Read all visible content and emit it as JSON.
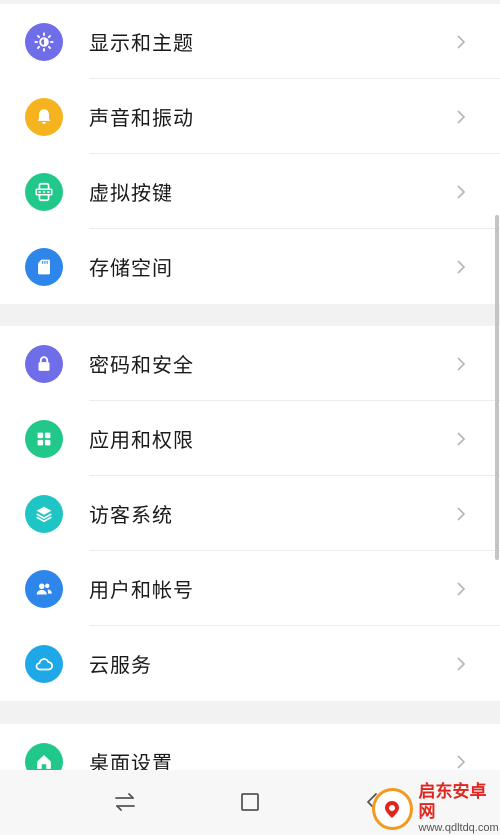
{
  "groups": [
    {
      "items": [
        {
          "label": "显示和主题",
          "icon": "brightness-icon",
          "color": "#6f6de8"
        },
        {
          "label": "声音和振动",
          "icon": "bell-icon",
          "color": "#f5b320"
        },
        {
          "label": "虚拟按键",
          "icon": "virtual-keys-icon",
          "color": "#22c88a"
        },
        {
          "label": "存储空间",
          "icon": "sd-card-icon",
          "color": "#2f86ea"
        }
      ]
    },
    {
      "items": [
        {
          "label": "密码和安全",
          "icon": "lock-icon",
          "color": "#6f6de8"
        },
        {
          "label": "应用和权限",
          "icon": "apps-grid-icon",
          "color": "#22c88a"
        },
        {
          "label": "访客系统",
          "icon": "layers-icon",
          "color": "#1fc4c4"
        },
        {
          "label": "用户和帐号",
          "icon": "users-icon",
          "color": "#2f86ea"
        },
        {
          "label": "云服务",
          "icon": "cloud-icon",
          "color": "#1ea8e8"
        }
      ]
    },
    {
      "items": [
        {
          "label": "桌面设置",
          "icon": "home-icon",
          "color": "#22c88a"
        }
      ]
    }
  ],
  "navbar": {
    "buttons": [
      "switch-apps-icon",
      "home-square-icon",
      "back-icon"
    ]
  },
  "watermark": {
    "title": "启东安卓网",
    "url": "www.qdltdq.com"
  }
}
